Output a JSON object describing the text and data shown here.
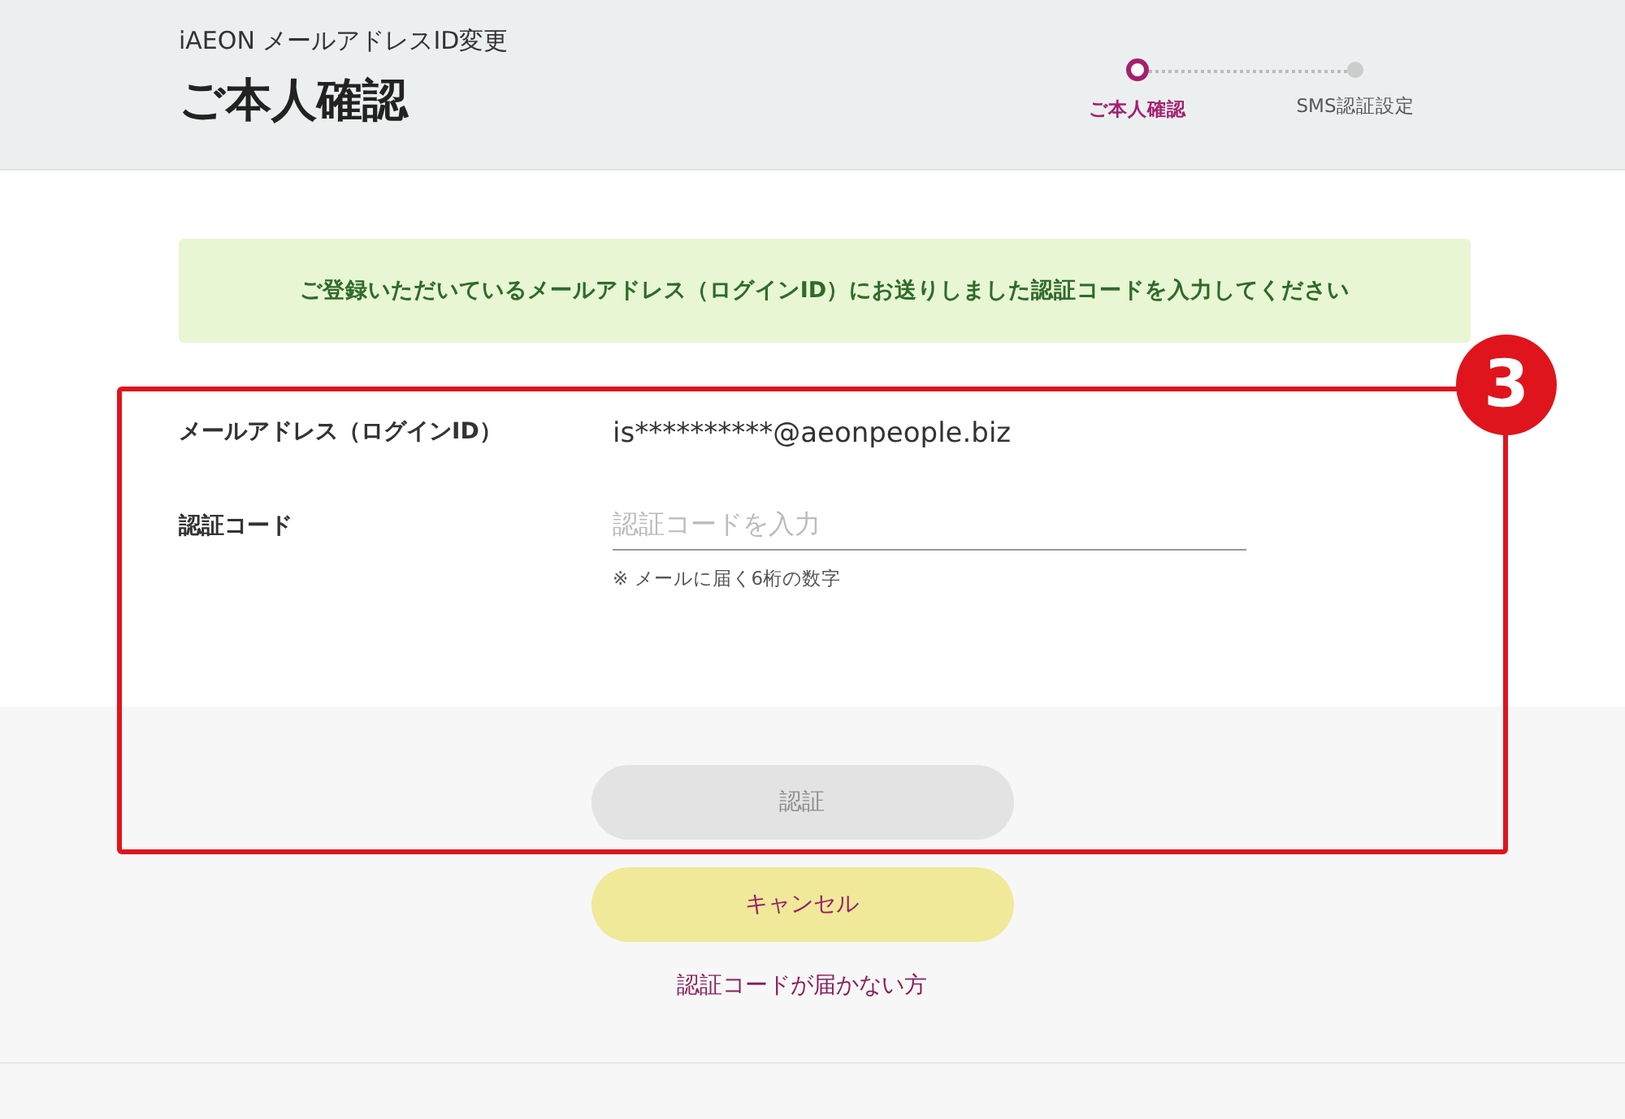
{
  "header": {
    "subtitle": "iAEON メールアドレスID変更",
    "title": "ご本人確認"
  },
  "steps": [
    {
      "label": "ご本人確認",
      "selected": true
    },
    {
      "label": "SMS認証設定",
      "selected": false
    }
  ],
  "notice": "ご登録いただいているメールアドレス（ログインID）にお送りしました認証コードを入力してください",
  "form": {
    "email_label": "メールアドレス（ログインID）",
    "email_value": "is**********@aeonpeople.biz",
    "code_label": "認証コード",
    "code_placeholder": "認証コードを入力",
    "code_hint": "※ メールに届く6桁の数字"
  },
  "verify_button": {
    "label": "認証",
    "disabled": true
  },
  "cancel_button": "キャンセル",
  "help_link": "認証コードが届かない方",
  "callout": {
    "number": "3"
  }
}
